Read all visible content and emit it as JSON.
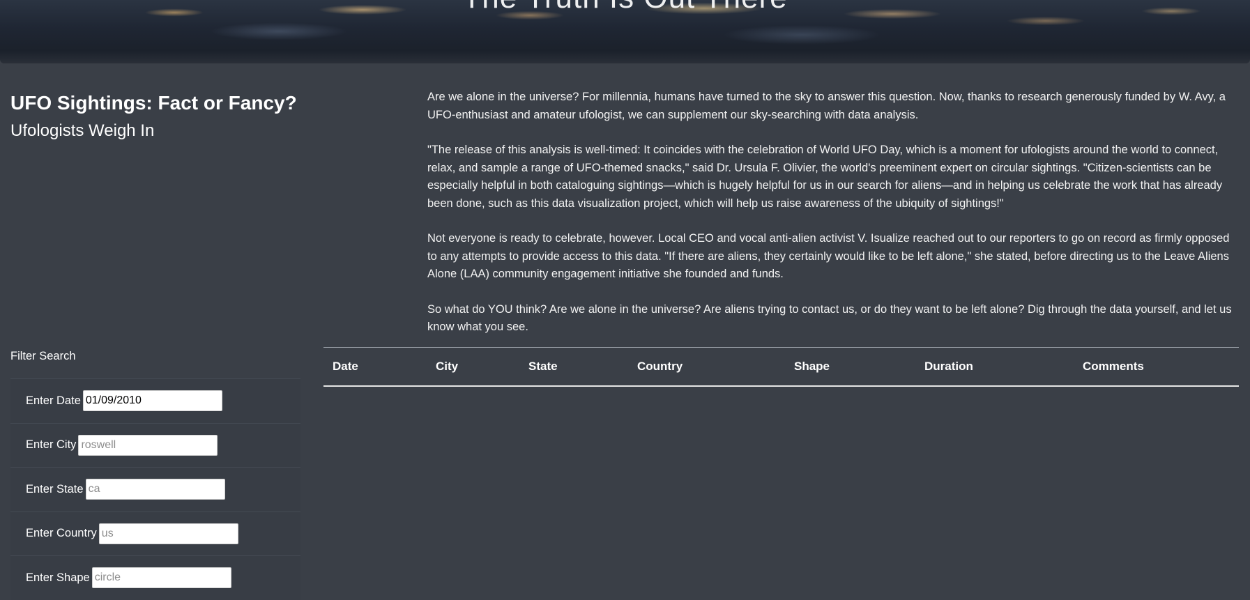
{
  "hero": {
    "title": "The Truth Is Out There"
  },
  "headline": {
    "main": "UFO Sightings: Fact or Fancy?",
    "sub": "Ufologists Weigh In"
  },
  "article": {
    "paragraphs": [
      "Are we alone in the universe? For millennia, humans have turned to the sky to answer this question. Now, thanks to research generously funded by W. Avy, a UFO-enthusiast and amateur ufologist, we can supplement our sky-searching with data analysis.",
      "\"The release of this analysis is well-timed: It coincides with the celebration of World UFO Day, which is a moment for ufologists around the world to connect, relax, and sample a range of UFO-themed snacks,\" said Dr. Ursula F. Olivier, the world's preeminent expert on circular sightings. \"Citizen-scientists can be especially helpful in both cataloguing sightings—which is hugely helpful for us in our search for aliens—and in helping us celebrate the work that has already been done, such as this data visualization project, which will help us raise awareness of the ubiquity of sightings!\"",
      "Not everyone is ready to celebrate, however. Local CEO and vocal anti-alien activist V. Isualize reached out to our reporters to go on record as firmly opposed to any attempts to provide access to this data. \"If there are aliens, they certainly would like to be left alone,\" she stated, before directing us to the Leave Aliens Alone (LAA) community engagement initiative she founded and funds.",
      "So what do YOU think? Are we alone in the universe? Are aliens trying to contact us, or do they want to be left alone? Dig through the data yourself, and let us know what you see."
    ]
  },
  "filters": {
    "title": "Filter Search",
    "date": {
      "label": "Enter Date",
      "value": "01/09/2010",
      "placeholder": ""
    },
    "city": {
      "label": "Enter City",
      "value": "",
      "placeholder": "roswell"
    },
    "state": {
      "label": "Enter State",
      "value": "",
      "placeholder": "ca"
    },
    "country": {
      "label": "Enter Country",
      "value": "",
      "placeholder": "us"
    },
    "shape": {
      "label": "Enter Shape",
      "value": "",
      "placeholder": "circle"
    }
  },
  "table": {
    "headers": [
      "Date",
      "City",
      "State",
      "Country",
      "Shape",
      "Duration",
      "Comments"
    ]
  }
}
